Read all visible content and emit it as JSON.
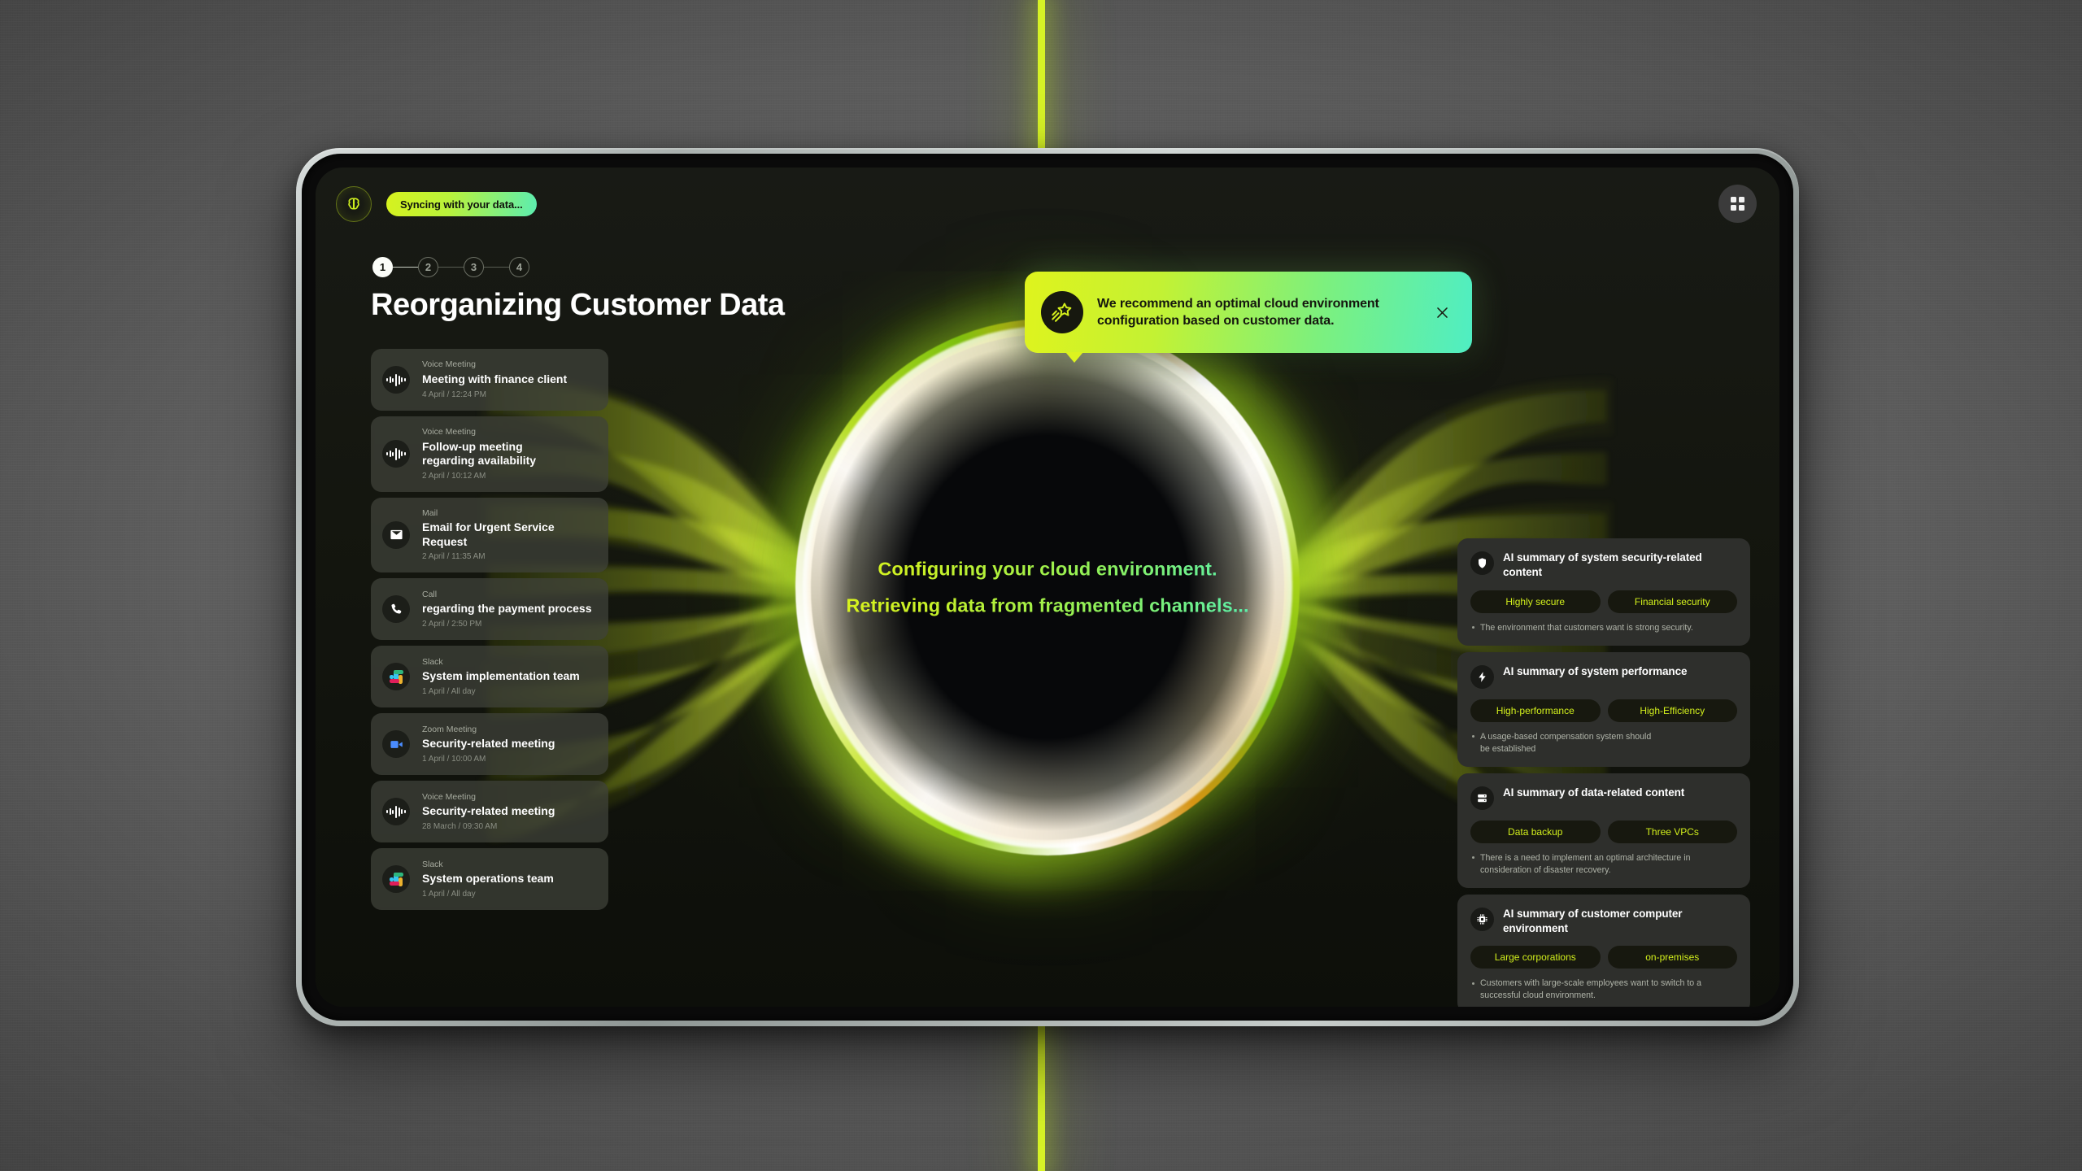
{
  "theme": {
    "accent_green": "#d6f226",
    "accent_mint": "#4feec3",
    "tag_text": "#d2ef1c",
    "screen_bg": "#131512",
    "card_bg": "#40423a",
    "ai_card_bg": "#2e2f2c"
  },
  "accent_line": {
    "name": "vertical-accent-line",
    "color": "#d6f226"
  },
  "topbar": {
    "logo_icon": "brain-logo-icon",
    "sync_status": "Syncing with your data...",
    "grid_button_icon": "grid-apps-icon"
  },
  "steps": {
    "items": [
      {
        "label": "1",
        "active": true
      },
      {
        "label": "2",
        "active": false
      },
      {
        "label": "3",
        "active": false
      },
      {
        "label": "4",
        "active": false
      }
    ]
  },
  "page_title": "Reorganizing Customer Data",
  "center_status": {
    "line1": "Configuring your cloud environment.",
    "line2": "Retrieving data from fragmented channels..."
  },
  "sources": [
    {
      "kind": "Voice Meeting",
      "title": "Meeting with finance client",
      "time": "4 April / 12:24 PM",
      "icon": "voice-waveform-icon"
    },
    {
      "kind": "Voice Meeting",
      "title": "Follow-up meeting regarding availability",
      "time": "2 April / 10:12 AM",
      "icon": "voice-waveform-icon"
    },
    {
      "kind": "Mail",
      "title": "Email for Urgent Service Request",
      "time": "2 April / 11:35 AM",
      "icon": "mail-envelope-icon"
    },
    {
      "kind": "Call",
      "title": "regarding the payment process",
      "time": "2 April / 2:50 PM",
      "icon": "phone-call-icon"
    },
    {
      "kind": "Slack",
      "title": "System implementation team",
      "time": "1 April / All day",
      "icon": "slack-icon"
    },
    {
      "kind": "Zoom Meeting",
      "title": "Security-related meeting",
      "time": "1 April / 10:00 AM",
      "icon": "zoom-video-icon"
    },
    {
      "kind": "Voice Meeting",
      "title": "Security-related meeting",
      "time": "28 March / 09:30 AM",
      "icon": "voice-waveform-icon"
    },
    {
      "kind": "Slack",
      "title": "System operations team",
      "time": "1 April / All day",
      "icon": "slack-icon"
    }
  ],
  "ai_summaries": [
    {
      "icon": "shield-icon",
      "title": "AI summary of system security-related content",
      "tags": [
        "Highly secure",
        "Financial security"
      ],
      "bullets": [
        "The environment that customers want is strong security."
      ]
    },
    {
      "icon": "lightning-bolt-icon",
      "title": "AI summary of system performance",
      "tags": [
        "High-performance",
        "High-Efficiency"
      ],
      "bullets": [
        "A usage-based compensation system should be established"
      ]
    },
    {
      "icon": "server-rack-icon",
      "title": "AI summary of data-related content",
      "tags": [
        "Data backup",
        "Three VPCs"
      ],
      "bullets": [
        "There is a need to implement an optimal architecture in consideration of disaster recovery."
      ]
    },
    {
      "icon": "cpu-chip-icon",
      "title": "AI summary of customer computer environment",
      "tags": [
        "Large corporations",
        "on-premises"
      ],
      "bullets": [
        "Customers with large-scale employees want to switch to a successful cloud environment."
      ]
    }
  ],
  "toast": {
    "icon": "shooting-star-icon",
    "message": "We recommend an optimal cloud environment configuration based on customer data.",
    "close_icon": "close-x-icon"
  }
}
